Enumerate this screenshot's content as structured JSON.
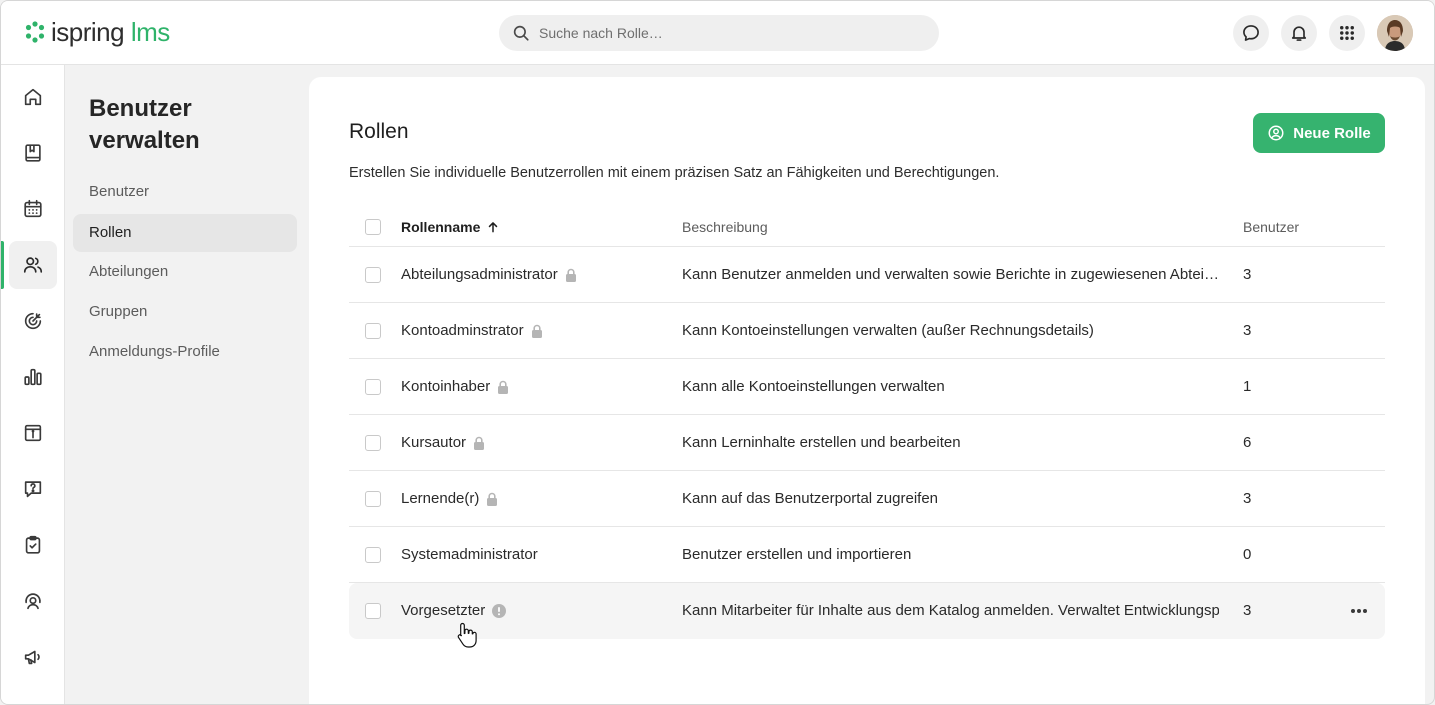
{
  "brand": {
    "name_part1": "ispring",
    "name_part2": "lms",
    "color": "#2fb36a"
  },
  "search": {
    "placeholder": "Suche nach Rolle…"
  },
  "header_icons": [
    "chat-icon",
    "bell-icon",
    "apps-grid-icon",
    "user-avatar"
  ],
  "rail": {
    "items": [
      "home-icon",
      "book-icon",
      "calendar-icon",
      "users-icon",
      "target-icon",
      "bar-chart-icon",
      "info-board-icon",
      "question-icon",
      "clipboard-check-icon",
      "support-agent-icon",
      "megaphone-icon"
    ],
    "active_index": 3
  },
  "subnav": {
    "title": "Benutzer verwalten",
    "items": [
      {
        "label": "Benutzer"
      },
      {
        "label": "Rollen",
        "active": true
      },
      {
        "label": "Abteilungen"
      },
      {
        "label": "Gruppen"
      },
      {
        "label": "Anmeldungs-Profile"
      }
    ]
  },
  "main": {
    "title": "Rollen",
    "description": "Erstellen Sie individuelle Benutzerrollen mit einem präzisen Satz an Fähigkeiten und Berechtigungen.",
    "new_role_label": "Neue Rolle",
    "accent": "#36b36f"
  },
  "table": {
    "columns": {
      "name": "Rollenname",
      "description": "Beschreibung",
      "users": "Benutzer"
    },
    "rows": [
      {
        "name": "Abteilungsadministrator",
        "description": "Kann Benutzer anmelden und verwalten sowie Berichte in zugewiesenen Abteil…",
        "users": "3",
        "badge": "lock"
      },
      {
        "name": "Kontoadminstrator",
        "description": "Kann Kontoeinstellungen verwalten (außer Rechnungsdetails)",
        "users": "3",
        "badge": "lock"
      },
      {
        "name": "Kontoinhaber",
        "description": "Kann alle Kontoeinstellungen verwalten",
        "users": "1",
        "badge": "lock"
      },
      {
        "name": "Kursautor",
        "description": "Kann Lerninhalte erstellen und bearbeiten",
        "users": "6",
        "badge": "lock"
      },
      {
        "name": "Lernende(r)",
        "description": "Kann auf das Benutzerportal zugreifen",
        "users": "3",
        "badge": "lock"
      },
      {
        "name": "Systemadministrator",
        "description": "Benutzer erstellen und importieren",
        "users": "0",
        "badge": "none"
      },
      {
        "name": "Vorgesetzter",
        "description": "Kann Mitarbeiter für Inhalte aus dem Katalog anmelden. Verwaltet Entwicklungsp",
        "users": "3",
        "badge": "info"
      }
    ]
  }
}
